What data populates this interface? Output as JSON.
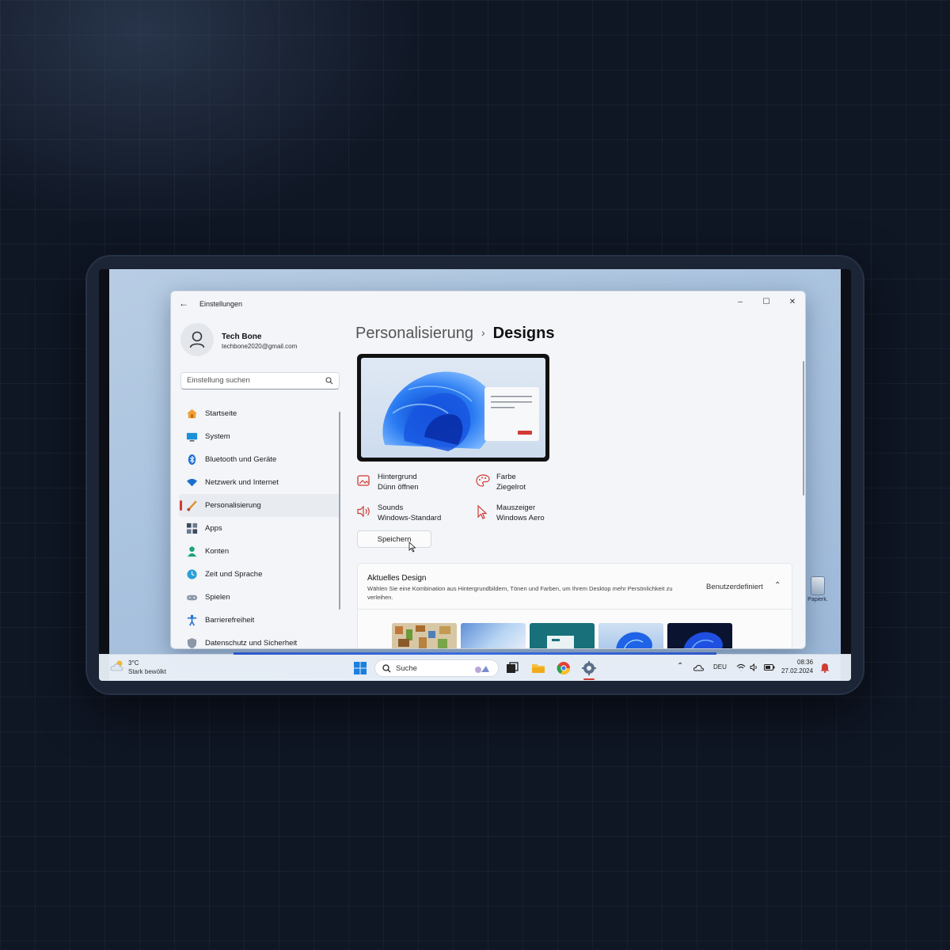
{
  "window": {
    "title": "Einstellungen",
    "back_icon": "back-arrow-icon",
    "controls": {
      "minimize": "–",
      "maximize": "☐",
      "close": "✕"
    }
  },
  "profile": {
    "name": "Tech Bone",
    "email": "techbone2020@gmail.com"
  },
  "search": {
    "placeholder": "Einstellung suchen"
  },
  "sidebar": {
    "items": [
      {
        "label": "Startseite",
        "icon": "home-icon",
        "active": false
      },
      {
        "label": "System",
        "icon": "monitor-icon",
        "active": false
      },
      {
        "label": "Bluetooth und Geräte",
        "icon": "bluetooth-icon",
        "active": false
      },
      {
        "label": "Netzwerk und Internet",
        "icon": "wifi-icon",
        "active": false
      },
      {
        "label": "Personalisierung",
        "icon": "brush-icon",
        "active": true
      },
      {
        "label": "Apps",
        "icon": "apps-icon",
        "active": false
      },
      {
        "label": "Konten",
        "icon": "account-icon",
        "active": false
      },
      {
        "label": "Zeit und Sprache",
        "icon": "globe-clock-icon",
        "active": false
      },
      {
        "label": "Spielen",
        "icon": "gamepad-icon",
        "active": false
      },
      {
        "label": "Barrierefreiheit",
        "icon": "accessibility-icon",
        "active": false
      },
      {
        "label": "Datenschutz und Sicherheit",
        "icon": "shield-icon",
        "active": false
      }
    ]
  },
  "breadcrumb": {
    "parent": "Personalisierung",
    "separator": "›",
    "current": "Designs"
  },
  "theme_attributes": {
    "background": {
      "title": "Hintergrund",
      "value": "Dünn öffnen",
      "icon": "picture-icon"
    },
    "color": {
      "title": "Farbe",
      "value": "Ziegelrot",
      "icon": "palette-icon"
    },
    "sounds": {
      "title": "Sounds",
      "value": "Windows-Standard",
      "icon": "speaker-icon"
    },
    "cursor": {
      "title": "Mauszeiger",
      "value": "Windows Aero",
      "icon": "pointer-icon"
    }
  },
  "save_button": {
    "label": "Speichern"
  },
  "current_theme": {
    "title": "Aktuelles Design",
    "description": "Wählen Sie eine Kombination aus Hintergrundbildern, Tönen und Farben, um Ihrem Desktop mehr Persönlichkeit zu verleihen.",
    "value": "Benutzerdefiniert",
    "expanded": true,
    "thumbnails": [
      "mosaic-theme",
      "glow-theme",
      "teal-theme",
      "bloom-light-theme",
      "bloom-dark-theme"
    ]
  },
  "taskbar": {
    "weather": {
      "temp": "3°C",
      "desc": "Stark bewölkt"
    },
    "search_label": "Suche",
    "language": "DEU",
    "time": "08:36",
    "date": "27.02.2024"
  },
  "colors": {
    "accent": "#d13b33",
    "taskbar_accent": "#3b6ee0",
    "selected_bg": "#e8ebf0"
  }
}
